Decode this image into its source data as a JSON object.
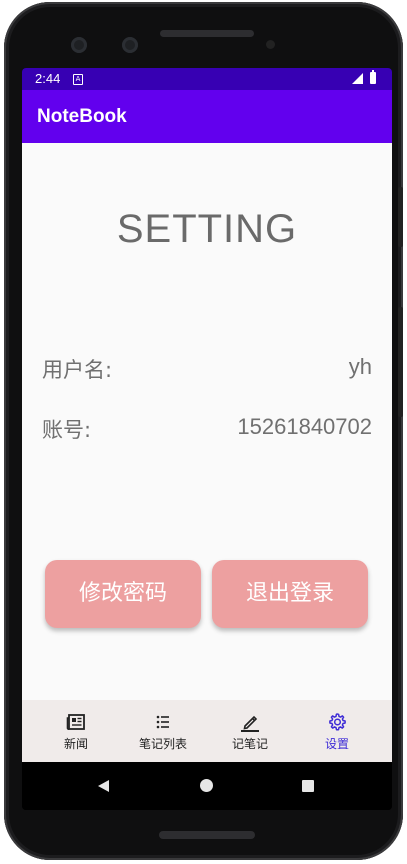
{
  "status_bar": {
    "time": "2:44",
    "notification_letter": "A"
  },
  "app_bar": {
    "title": "NoteBook"
  },
  "main": {
    "heading": "SETTING",
    "rows": [
      {
        "label": "用户名:",
        "value": "yh"
      },
      {
        "label": "账号:",
        "value": "15261840702"
      }
    ],
    "buttons": {
      "change_password": "修改密码",
      "logout": "退出登录"
    }
  },
  "bottom_nav": [
    {
      "label": "新闻",
      "icon": "newspaper-icon",
      "active": false
    },
    {
      "label": "笔记列表",
      "icon": "list-icon",
      "active": false
    },
    {
      "label": "记笔记",
      "icon": "pencil-icon",
      "active": false
    },
    {
      "label": "设置",
      "icon": "gear-icon",
      "active": true
    }
  ],
  "colors": {
    "status_bar": "#3700b3",
    "app_bar": "#6200ee",
    "button": "#eda0a0",
    "nav_active": "#3d2bd6",
    "nav_background": "#f0ebea"
  }
}
